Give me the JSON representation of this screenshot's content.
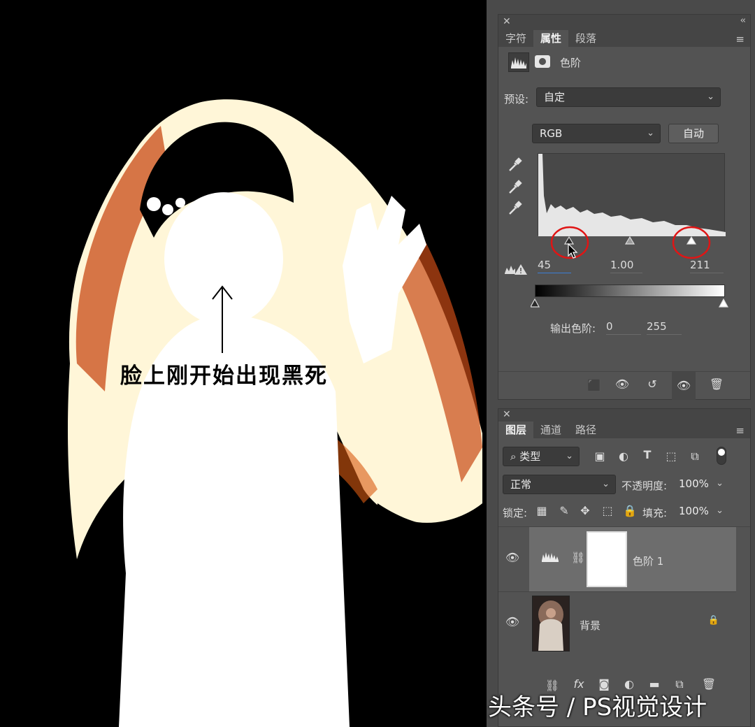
{
  "canvas": {
    "annotation": "脸上刚开始出现黑死"
  },
  "properties_panel": {
    "tabs": [
      "字符",
      "属性",
      "段落"
    ],
    "active_tab": "属性",
    "adjustment_title": "色阶",
    "preset_label": "预设:",
    "preset_value": "自定",
    "channel_value": "RGB",
    "auto_button": "自动",
    "input_black": "45",
    "input_gamma": "1.00",
    "input_white": "211",
    "output_label": "输出色阶:",
    "output_black": "0",
    "output_white": "255"
  },
  "layers_panel": {
    "tabs": [
      "图层",
      "通道",
      "路径"
    ],
    "active_tab": "图层",
    "filter_value": "类型",
    "blend_mode": "正常",
    "opacity_label": "不透明度:",
    "opacity_value": "100%",
    "lock_label": "锁定:",
    "fill_label": "填充:",
    "fill_value": "100%",
    "layers": [
      {
        "name": "色阶 1",
        "selected": true
      },
      {
        "name": "背景",
        "selected": false
      }
    ]
  },
  "watermark": "头条号 / PS视觉设计"
}
